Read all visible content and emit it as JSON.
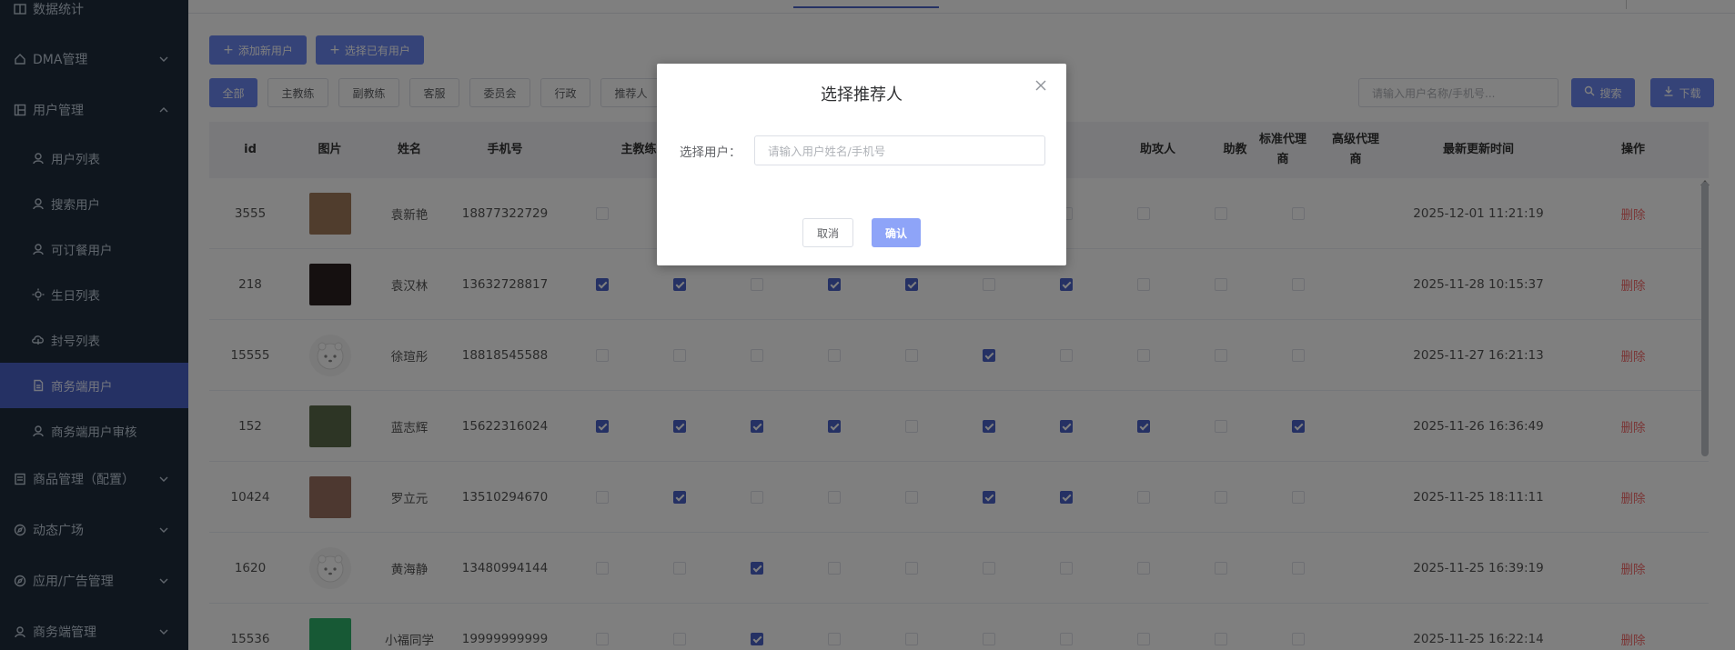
{
  "sidebar": {
    "items": [
      {
        "label": "数据统计",
        "icon": "book-icon"
      },
      {
        "label": "DMA管理",
        "icon": "home-icon"
      },
      {
        "label": "用户管理",
        "icon": "grid-icon"
      },
      {
        "label": "用户列表",
        "icon": "user-icon"
      },
      {
        "label": "搜索用户",
        "icon": "user-icon"
      },
      {
        "label": "可订餐用户",
        "icon": "user-icon"
      },
      {
        "label": "生日列表",
        "icon": "sun-icon"
      },
      {
        "label": "封号列表",
        "icon": "cloud-icon"
      },
      {
        "label": "商务端用户",
        "icon": "document-icon"
      },
      {
        "label": "商务端用户审核",
        "icon": "user-icon"
      },
      {
        "label": "商品管理（配置）",
        "icon": "list-icon"
      },
      {
        "label": "动态广场",
        "icon": "compass-icon"
      },
      {
        "label": "应用/广告管理",
        "icon": "compass-icon"
      },
      {
        "label": "商务端管理",
        "icon": "user-icon"
      }
    ]
  },
  "toolbar": {
    "add_new_user": "添加新用户",
    "select_existing_user": "选择已有用户",
    "search_placeholder": "请输入用户名称/手机号...",
    "search_button": "搜索",
    "download_button": "下载"
  },
  "filters": [
    "全部",
    "主教练",
    "副教练",
    "客服",
    "委员会",
    "行政",
    "推荐人"
  ],
  "table": {
    "headers": {
      "id": "id",
      "image": "图片",
      "name": "姓名",
      "phone": "手机号",
      "head_coach": "主教练",
      "assist_attacker": "助攻人",
      "assistant_coach": "助教",
      "std_agent": "标准代理商",
      "adv_agent": "高级代理商",
      "updated": "最新更新时间",
      "action": "操作"
    },
    "action_label": "删除",
    "rows": [
      {
        "id": "3555",
        "name": "袁新艳",
        "phone": "18877322729",
        "updated": "2025-12-01 11:21:19",
        "checks": [
          false,
          false,
          false,
          false,
          false,
          false,
          false,
          false,
          false,
          false
        ],
        "avatar": "#a07a5a"
      },
      {
        "id": "218",
        "name": "袁汉林",
        "phone": "13632728817",
        "updated": "2025-11-28 10:15:37",
        "checks": [
          true,
          true,
          false,
          true,
          true,
          false,
          true,
          false,
          false,
          false
        ],
        "avatar": "#2a2020"
      },
      {
        "id": "15555",
        "name": "徐瑄彤",
        "phone": "18818545588",
        "updated": "2025-11-27 16:21:13",
        "checks": [
          false,
          false,
          false,
          false,
          false,
          true,
          false,
          false,
          false,
          false
        ],
        "avatar": "default"
      },
      {
        "id": "152",
        "name": "蓝志辉",
        "phone": "15622316024",
        "updated": "2025-11-26 16:36:49",
        "checks": [
          true,
          true,
          true,
          true,
          false,
          true,
          true,
          true,
          false,
          true
        ],
        "avatar": "#5a6a4a"
      },
      {
        "id": "10424",
        "name": "罗立元",
        "phone": "13510294670",
        "updated": "2025-11-25 18:11:11",
        "checks": [
          false,
          true,
          false,
          false,
          false,
          true,
          true,
          false,
          false,
          false
        ],
        "avatar": "#9a7060"
      },
      {
        "id": "1620",
        "name": "黄海静",
        "phone": "13480994144",
        "updated": "2025-11-25 16:39:19",
        "checks": [
          false,
          false,
          true,
          false,
          false,
          false,
          false,
          false,
          false,
          false
        ],
        "avatar": "default"
      },
      {
        "id": "15536",
        "name": "小福同学",
        "phone": "19999999999",
        "updated": "2025-11-25 16:22:14",
        "checks": [
          false,
          false,
          true,
          false,
          false,
          false,
          false,
          false,
          false,
          false
        ],
        "avatar": "#2fb36a"
      }
    ]
  },
  "dialog": {
    "title": "选择推荐人",
    "field_label": "选择用户：",
    "field_placeholder": "请输入用户姓名/手机号",
    "cancel": "取消",
    "confirm": "确认"
  },
  "colors": {
    "sidebar_bg": "#1f2d3d",
    "accent": "#4a62c9",
    "danger": "#f56c6c"
  }
}
